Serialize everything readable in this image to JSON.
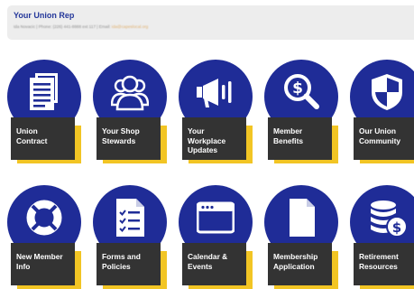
{
  "rep": {
    "title": "Your Union Rep",
    "contact": "Ida Novacic | Phone: (226) 441-8888 ext 117 | Email:",
    "email": "ida@capeslocal.org"
  },
  "tiles": [
    {
      "line1": "Union",
      "line2": "Contract",
      "line3": "",
      "icon": "document-icon"
    },
    {
      "line1": "Your Shop",
      "line2": "Stewards",
      "line3": "",
      "icon": "people-icon"
    },
    {
      "line1": "Your",
      "line2": "Workplace",
      "line3": "Updates",
      "icon": "megaphone-icon"
    },
    {
      "line1": "Member",
      "line2": "Benefits",
      "line3": "",
      "icon": "dollar-search-icon"
    },
    {
      "line1": "Our Union",
      "line2": "Community",
      "line3": "",
      "icon": "shield-icon"
    },
    {
      "line1": "New Member",
      "line2": "Info",
      "line3": "",
      "icon": "lifebuoy-icon"
    },
    {
      "line1": "Forms and",
      "line2": "Policies",
      "line3": "",
      "icon": "checklist-icon"
    },
    {
      "line1": "Calendar &",
      "line2": "Events",
      "line3": "",
      "icon": "browser-window-icon"
    },
    {
      "line1": "Membership",
      "line2": "Application",
      "line3": "",
      "icon": "file-icon"
    },
    {
      "line1": "Retirement",
      "line2": "Resources",
      "line3": "",
      "icon": "coins-dollar-icon"
    }
  ],
  "colors": {
    "primary": "#1f2c97",
    "accent": "#f2c524",
    "label_bg": "#333333",
    "title": "#24379a"
  }
}
